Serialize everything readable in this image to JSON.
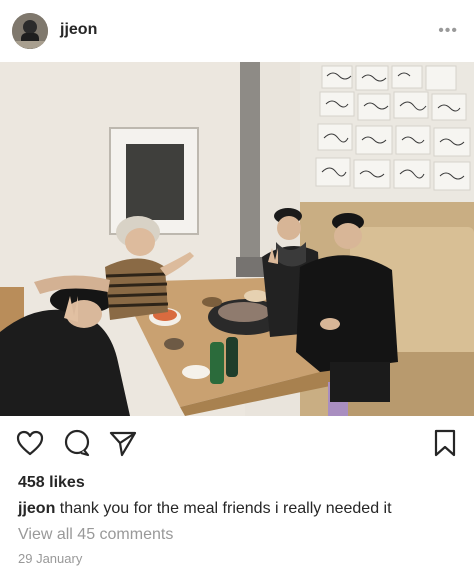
{
  "post": {
    "username": "jjeon",
    "more_label": "•••",
    "likes": "458 likes",
    "caption_user": "jjeon",
    "caption_text": " thank you for the meal friends i really needed it",
    "view_comments": "View all 45 comments",
    "date": "29 January"
  },
  "icons": {
    "header": [
      "avatar",
      "more-options-icon"
    ],
    "actions": [
      "heart-icon",
      "comment-icon",
      "share-icon",
      "bookmark-icon"
    ]
  },
  "colors": {
    "text": "#262626",
    "muted": "#999999",
    "background": "#ffffff"
  }
}
